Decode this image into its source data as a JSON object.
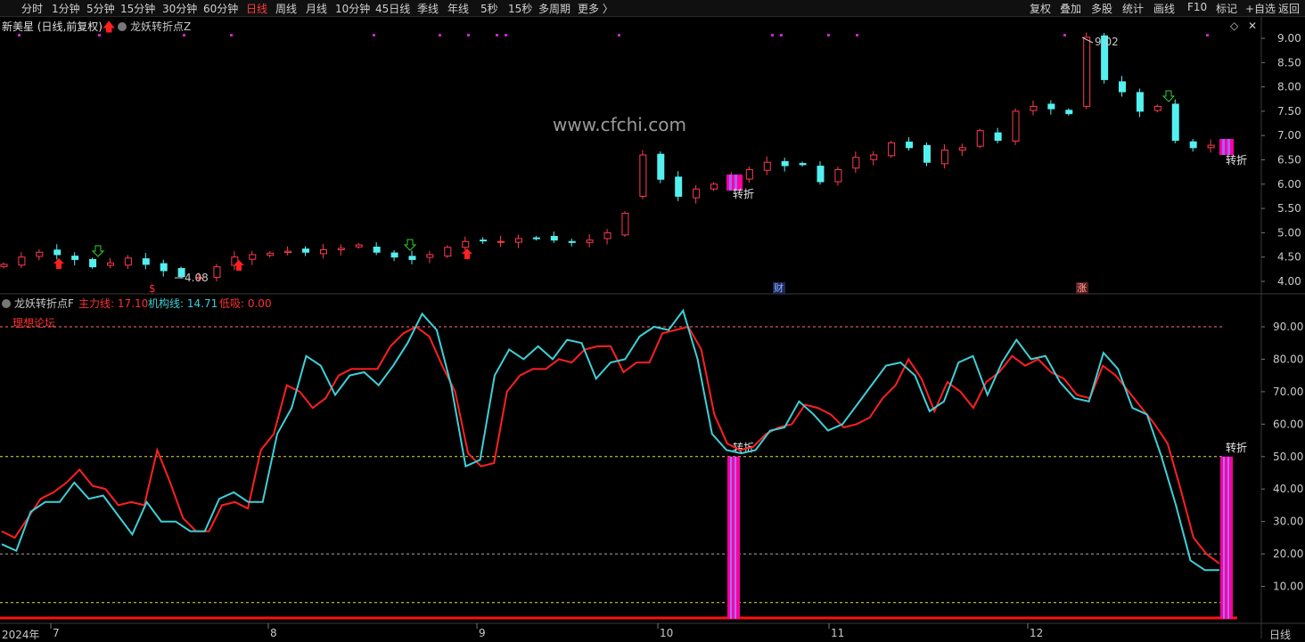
{
  "toolbar": {
    "left_items": [
      "分时",
      "1分钟",
      "5分钟",
      "15分钟",
      "30分钟",
      "60分钟",
      "日线",
      "周线",
      "月线",
      "10分钟",
      "45日线",
      "季线",
      "年线",
      "5秒",
      "15秒",
      "多周期",
      "更多 〉"
    ],
    "active": "日线",
    "right_items": [
      "复权",
      "叠加",
      "多股",
      "统计",
      "画线",
      "F10",
      "标记",
      "+自选",
      "返回"
    ]
  },
  "main_panel": {
    "stock_title": "新美星 (日线,前复权)",
    "indicator_name": "龙妖转折点Z",
    "watermark": "www.cfchi.com",
    "price_axis": [
      "9.00",
      "8.50",
      "8.00",
      "7.50",
      "7.00",
      "6.50",
      "6.00",
      "5.50",
      "5.00",
      "4.50",
      "4.00"
    ],
    "high_label": "9.02",
    "low_label": "4.08",
    "signal_label": "转折",
    "marker_cai": "财",
    "marker_zhang": "涨",
    "marker_dollar": "$"
  },
  "sub_panel": {
    "indicator_name": "龙妖转折点F",
    "main_line_label": "主力线: 17.10",
    "inst_line_label": "机构线: 14.71",
    "low_buy_label": "低吸: 0.00",
    "forum_label": "理想论坛",
    "signal_label": "转折",
    "value_axis": [
      "90.00",
      "80.00",
      "70.00",
      "60.00",
      "50.00",
      "40.00",
      "30.00",
      "20.00",
      "10.00"
    ]
  },
  "date_axis": {
    "year_label": "2024年",
    "months": [
      "7",
      "8",
      "9",
      "10",
      "11",
      "12"
    ],
    "period": "日线"
  },
  "colors": {
    "up": "#ff3b4f",
    "down": "#54f0f0",
    "main_line": "#ff2020",
    "inst_line": "#3ed0d8",
    "signal": "#ff00a0",
    "active_tab": "#ff3b3b"
  },
  "chart_data": {
    "type": "line",
    "x_range": [
      "2024-07",
      "2024-12"
    ],
    "price_ylim": [
      4.0,
      9.0
    ],
    "price_path": [
      4.35,
      4.5,
      4.6,
      4.55,
      4.45,
      4.3,
      4.38,
      4.48,
      4.35,
      4.22,
      4.1,
      4.08,
      4.3,
      4.5,
      4.55,
      4.58,
      4.62,
      4.6,
      4.65,
      4.68,
      4.75,
      4.6,
      4.5,
      4.45,
      4.55,
      4.7,
      4.82,
      4.85,
      4.82,
      4.88,
      4.88,
      4.85,
      4.8,
      4.85,
      5.0,
      5.4,
      6.6,
      6.1,
      5.75,
      5.9,
      6.0,
      6.15,
      6.3,
      6.45,
      6.38,
      6.4,
      6.05,
      6.3,
      6.55,
      6.6,
      6.85,
      6.75,
      6.45,
      6.7,
      6.75,
      7.1,
      6.9,
      7.5,
      7.6,
      7.55,
      7.45,
      9.02,
      8.15,
      7.9,
      7.5,
      7.6,
      6.9,
      6.75,
      6.8,
      6.75
    ],
    "sub_ylim": [
      0,
      100
    ],
    "series": [
      {
        "name": "主力线",
        "values": [
          27,
          25,
          31,
          37,
          39,
          42,
          46,
          41,
          40,
          35,
          36,
          35,
          52,
          42,
          31,
          27,
          27,
          35,
          36,
          34,
          52,
          57,
          72,
          70,
          65,
          68,
          75,
          77,
          77,
          77,
          84,
          88,
          90,
          87,
          78,
          70,
          51,
          47,
          48,
          70,
          75,
          77,
          77,
          80,
          79,
          83,
          84,
          84,
          76,
          79,
          79,
          88,
          89,
          90,
          83,
          63,
          54,
          52,
          53,
          57,
          59,
          60,
          66,
          65,
          63,
          59,
          60,
          62,
          68,
          72,
          80,
          74,
          64,
          73,
          70,
          65,
          73,
          76,
          81,
          78,
          80,
          76,
          74,
          69,
          68,
          78,
          75,
          70,
          65,
          60,
          54,
          40,
          25,
          20,
          17
        ]
      },
      {
        "name": "机构线",
        "values": [
          23,
          21,
          33,
          36,
          36,
          42,
          37,
          38,
          32,
          26,
          36,
          30,
          30,
          27,
          27,
          37,
          39,
          36,
          36,
          57,
          65,
          81,
          78,
          69,
          75,
          76,
          72,
          78,
          85,
          94,
          89,
          72,
          47,
          49,
          75,
          83,
          80,
          84,
          80,
          86,
          85,
          74,
          79,
          80,
          87,
          90,
          89,
          95,
          80,
          57,
          52,
          51,
          52,
          58,
          59,
          67,
          63,
          58,
          60,
          66,
          72,
          78,
          79,
          75,
          64,
          67,
          79,
          81,
          69,
          79,
          86,
          80,
          81,
          73,
          68,
          67,
          82,
          77,
          65,
          63,
          50,
          35,
          18,
          15,
          15
        ]
      }
    ],
    "signal_levels": {
      "top": 50,
      "low": 5
    },
    "reference_lines": [
      90,
      50,
      20,
      5
    ]
  }
}
